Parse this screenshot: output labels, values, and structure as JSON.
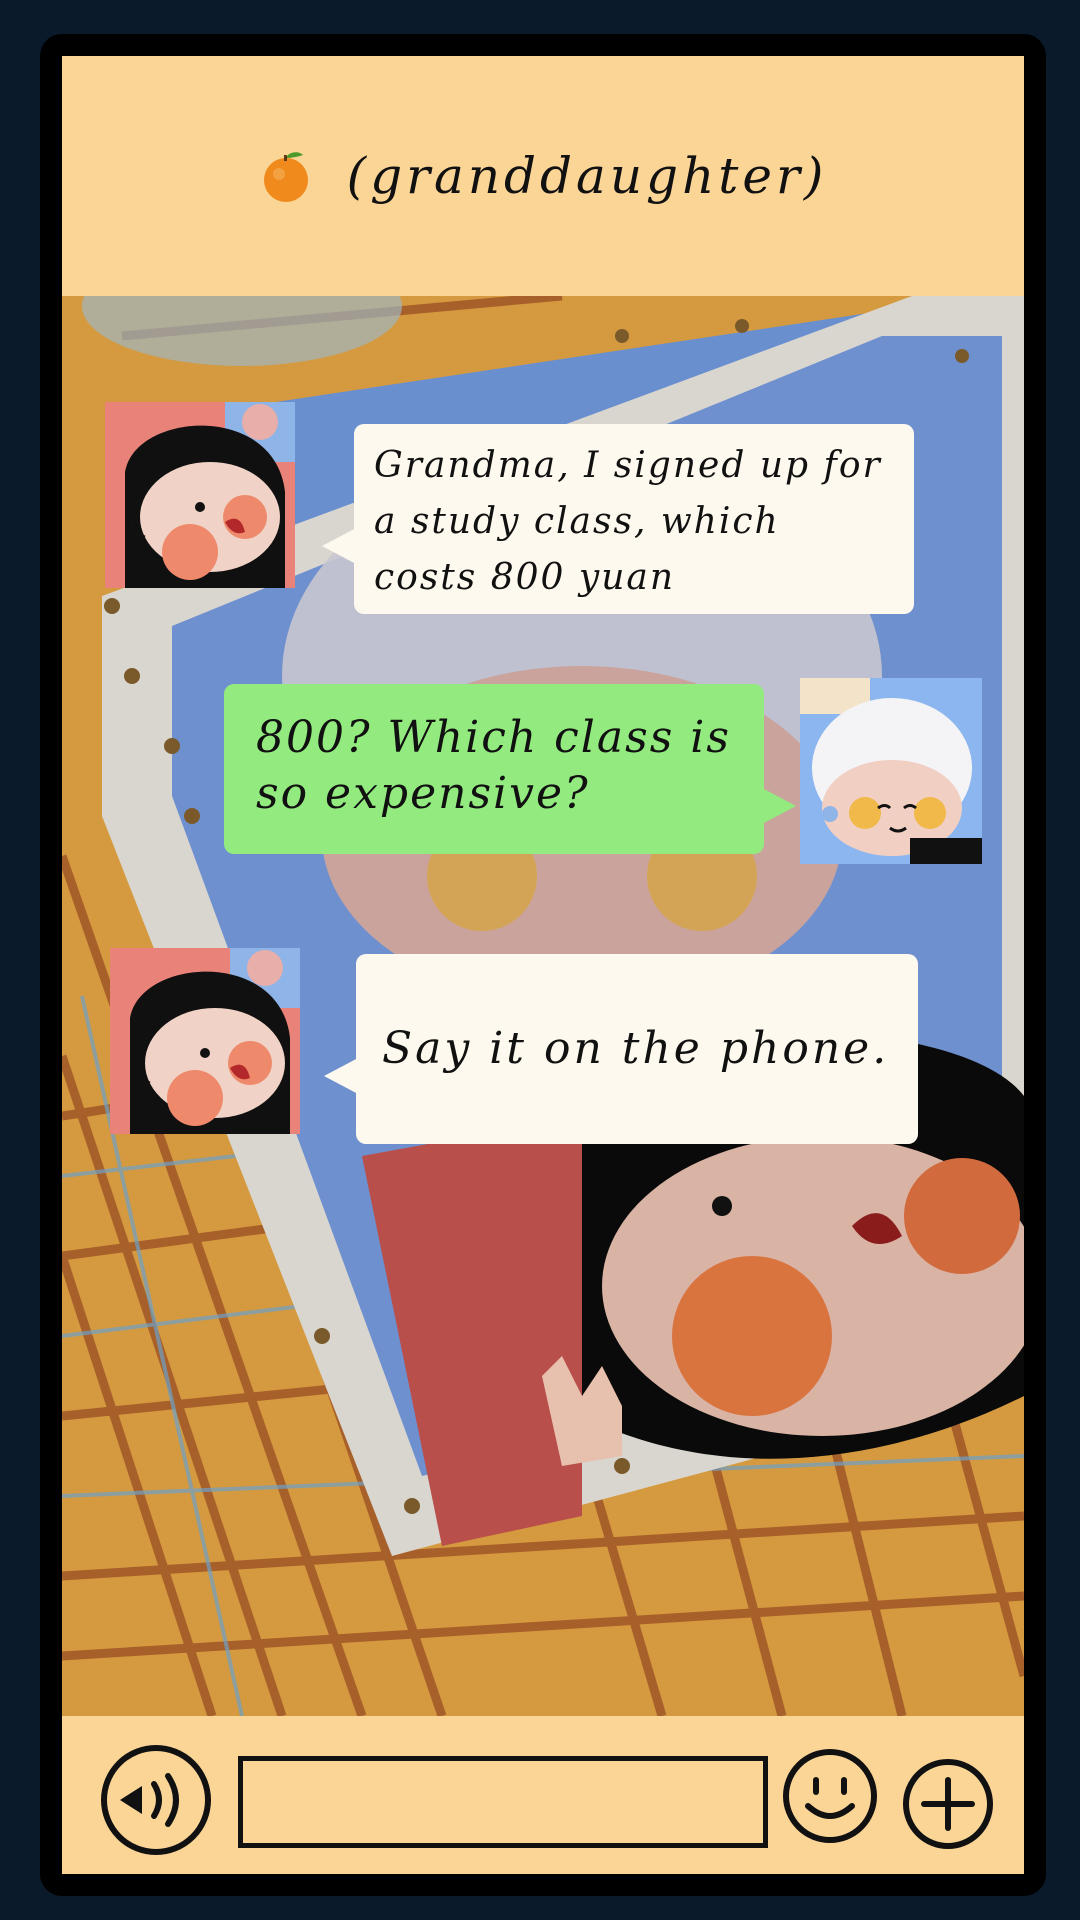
{
  "header": {
    "icon": "orange-emoji-icon",
    "title": "(granddaughter)"
  },
  "messages": [
    {
      "sender": "granddaughter",
      "side": "left",
      "text": "Grandma, I signed up for a study class, which costs 800 yuan"
    },
    {
      "sender": "grandma",
      "side": "right",
      "text": "800? Which class is so expensive?"
    },
    {
      "sender": "granddaughter",
      "side": "left",
      "text": "Say it on the phone."
    }
  ],
  "toolbar": {
    "voice_icon": "voice-icon",
    "input_value": "",
    "emoji_icon": "smiley-icon",
    "plus_icon": "plus-icon"
  },
  "colors": {
    "header_bg": "#fbd596",
    "incoming_bubble": "#fdf9ee",
    "outgoing_bubble": "#93eb80",
    "frame": "#000000"
  }
}
